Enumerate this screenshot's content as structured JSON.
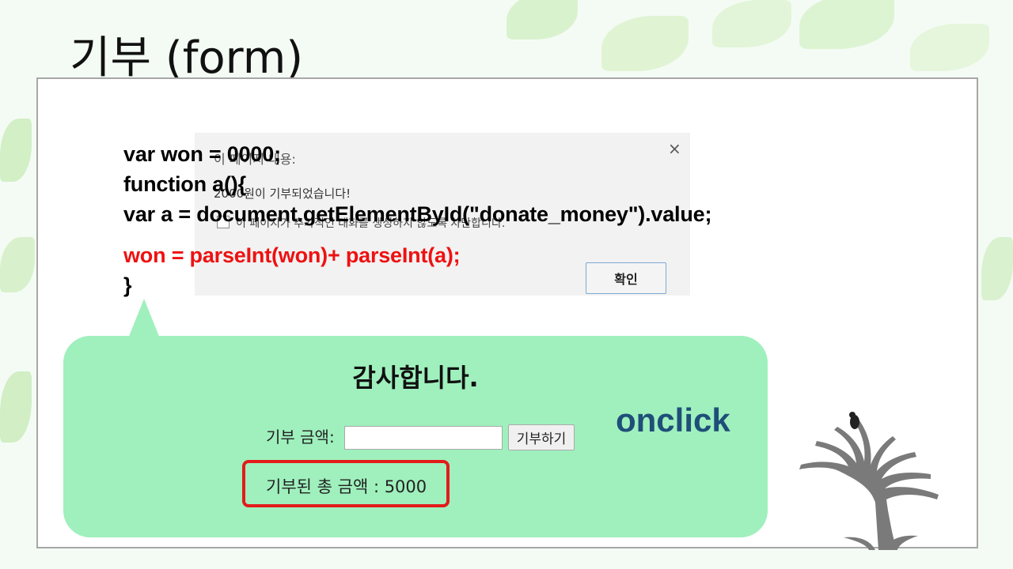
{
  "slide": {
    "title": "기부 (form)"
  },
  "dialog": {
    "title": "이 페이지 내용:",
    "message": "2000원이 기부되었습니다!",
    "checkbox_label": "이 페이지가 추가적인 대화를 생성하지 않도록 차단합니다.",
    "close_symbol": "×",
    "ok_label": "확인"
  },
  "code": {
    "line1": "var won = 0000;",
    "line2": "function a(){",
    "line3": "var a = document.getElementById(\"donate_money\").value;",
    "line4": "won = parseInt(won)+  parseInt(a);",
    "line5": "}"
  },
  "form": {
    "heading": "감사합니다.",
    "amount_label": "기부 금액:",
    "amount_value": "",
    "button_label": "기부하기",
    "total_text": "기부된 총 금액 : 5000"
  },
  "annotation": {
    "event_label": "onclick"
  },
  "colors": {
    "bubble": "#9ff0bd",
    "highlight_border": "#e31b1b",
    "code_highlight": "#ee1111",
    "annotation": "#1f4e79"
  }
}
